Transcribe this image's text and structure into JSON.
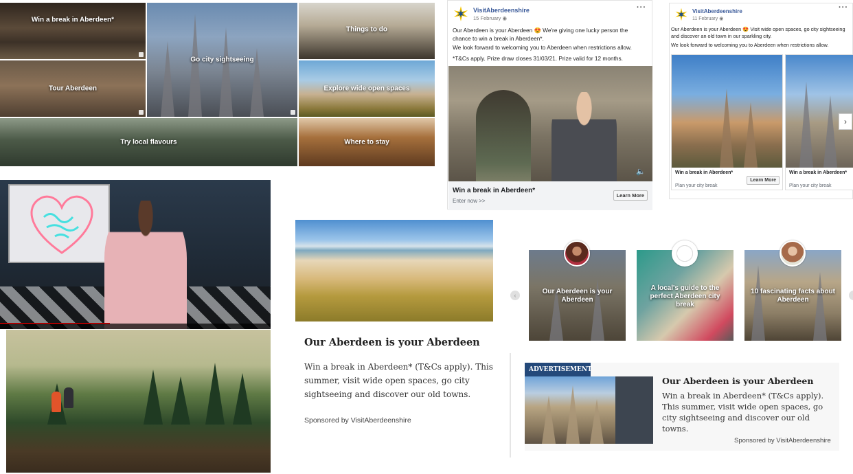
{
  "tiles": {
    "win": "Win a break in Aberdeen*",
    "sightseeing": "Go city sightseeing",
    "things": "Things to do",
    "tour": "Tour Aberdeen",
    "explore": "Explore wide open spaces",
    "flavours": "Try local flavours",
    "stay": "Where to stay"
  },
  "fb_ad1": {
    "page_name": "VisitAberdeenshire",
    "date": "15 February",
    "line1": "Our Aberdeen is your Aberdeen 😍 We're giving one lucky person the chance to win a break in Aberdeen*.",
    "line2": "We look forward to welcoming you to Aberdeen when restrictions allow.",
    "line3": "*T&Cs apply. Prize draw closes 31/03/21. Prize valid for 12 months.",
    "headline": "Win a break in Aberdeen*",
    "subline": "Enter now >>",
    "cta": "Learn More"
  },
  "fb_ad2": {
    "page_name": "VisitAberdeenshire",
    "date": "11 February",
    "line1": "Our Aberdeen is your Aberdeen 😍 Visit wide open spaces, go city sightseeing and discover an old town in our sparkling city.",
    "line2": "We look forward to welcoming you to Aberdeen when restrictions allow.",
    "cards": [
      {
        "title": "Win a break in Aberdeen*",
        "sub": "Plan your city break",
        "cta": "Learn More"
      },
      {
        "title": "Win a break in Aberdeen*",
        "sub": "Plan your city break"
      }
    ]
  },
  "native_ad": {
    "title": "Our Aberdeen is your Aberdeen",
    "body": "Win a break in Aberdeen* (T&Cs apply). This summer, visit wide open spaces, go city sightseeing and discover our old towns.",
    "sponsored": "Sponsored by VisitAberdeenshire"
  },
  "blog_cards": [
    {
      "title": "Our Aberdeen is your Aberdeen"
    },
    {
      "title": "A local's guide to the perfect Aberdeen city break"
    },
    {
      "title": "10 fascinating facts about Aberdeen"
    }
  ],
  "display_ad": {
    "tag": "ADVERTISEMENT",
    "title": "Our Aberdeen is your Aberdeen",
    "body": "Win a break in Aberdeen* (T&Cs apply). This summer, visit wide open spaces, go city sightseeing and discover our old towns.",
    "sponsored": "Sponsored by VisitAberdeenshire"
  },
  "icons": {
    "logo": "visitaberdeenshire-star-icon",
    "more": "more-options-icon",
    "globe": "globe-icon",
    "speaker": "speaker-icon",
    "next": "chevron-right-icon",
    "prev": "chevron-left-icon"
  },
  "colors": {
    "fb_link": "#385898",
    "ad_tag": "#24497a",
    "logo_yellow": "#f5c400",
    "logo_blue": "#1b4f8a"
  }
}
